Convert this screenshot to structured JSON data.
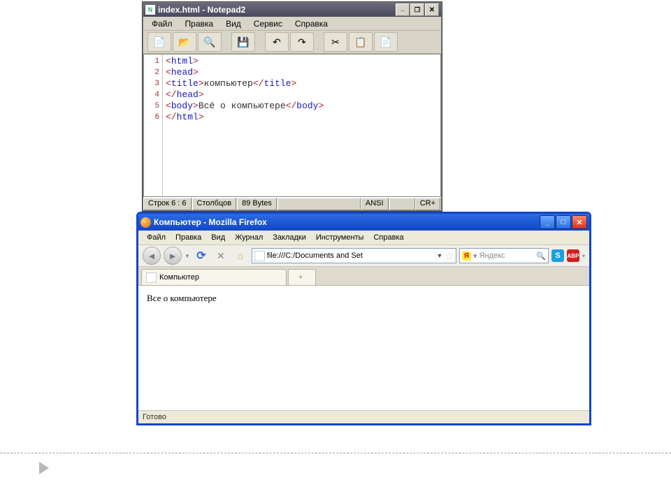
{
  "notepad": {
    "title": "index.html - Notepad2",
    "menu": [
      "Файл",
      "Правка",
      "Вид",
      "Сервис",
      "Справка"
    ],
    "toolbar_icons": [
      "new",
      "open",
      "browse",
      "save",
      "undo",
      "redo",
      "cut",
      "copy",
      "paste"
    ],
    "code_lines": [
      {
        "n": 1,
        "html": "<span class='pun'>&lt;</span><span class='tag'>html</span><span class='pun'>&gt;</span>"
      },
      {
        "n": 2,
        "html": "<span class='pun'>&lt;</span><span class='tag'>head</span><span class='pun'>&gt;</span>"
      },
      {
        "n": 3,
        "html": "<span class='pun'>&lt;</span><span class='tag'>title</span><span class='pun'>&gt;</span><span class='txt'>компьютер</span><span class='pun'>&lt;/</span><span class='tag'>title</span><span class='pun'>&gt;</span>"
      },
      {
        "n": 4,
        "html": "<span class='pun'>&lt;/</span><span class='tag'>head</span><span class='pun'>&gt;</span>"
      },
      {
        "n": 5,
        "html": "<span class='pun'>&lt;</span><span class='tag'>body</span><span class='pun'>&gt;</span><span class='txt'>Всё о компьютере</span><span class='pun'>&lt;/</span><span class='tag'>body</span><span class='pun'>&gt;</span>"
      },
      {
        "n": 6,
        "html": "<span class='pun'>&lt;/</span><span class='tag'>html</span><span class='pun'>&gt;</span>"
      }
    ],
    "status": {
      "lines": "Строк 6 : 6",
      "cols": "Столбцов",
      "size": "89 Bytes",
      "enc": "ANSI",
      "eol": "CR+"
    }
  },
  "firefox": {
    "title": "Компьютер - Mozilla Firefox",
    "menu": [
      "Файл",
      "Правка",
      "Вид",
      "Журнал",
      "Закладки",
      "Инструменты",
      "Справка"
    ],
    "url": "file:///C:/Documents and Set",
    "search_placeholder": "Яндекс",
    "tab_label": "Компьютер",
    "page_text": "Все о компьютере",
    "status": "Готово"
  }
}
